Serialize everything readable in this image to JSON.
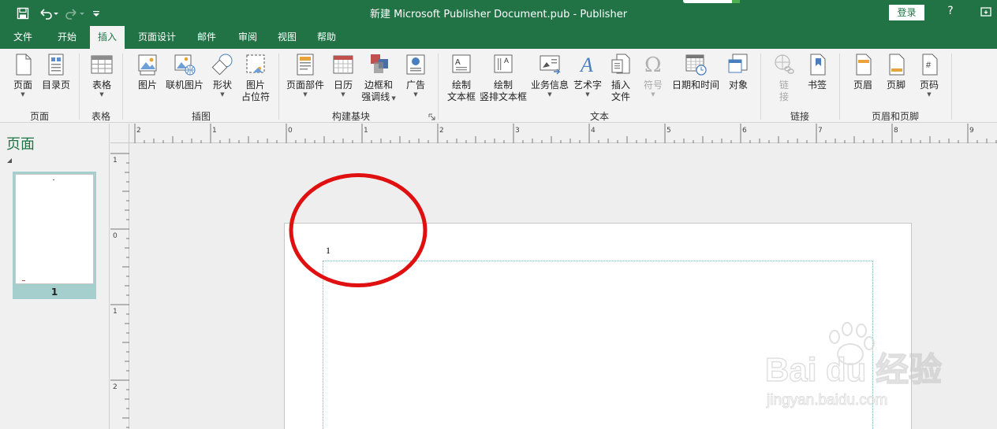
{
  "window": {
    "title": "新建 Microsoft Publisher Document.pub  -  Publisher",
    "login_label": "登录",
    "help_label": "?"
  },
  "tabs": [
    {
      "label": "文件",
      "active": false
    },
    {
      "label": "开始",
      "active": false
    },
    {
      "label": "插入",
      "active": true
    },
    {
      "label": "页面设计",
      "active": false
    },
    {
      "label": "邮件",
      "active": false
    },
    {
      "label": "审阅",
      "active": false
    },
    {
      "label": "视图",
      "active": false
    },
    {
      "label": "帮助",
      "active": false
    }
  ],
  "ribbon": {
    "buttons": {
      "page": "页面",
      "catalog_page": "目录页",
      "table": "表格",
      "picture": "图片",
      "online_picture": "联机图片",
      "shapes": "形状",
      "picture_placeholder_1": "图片",
      "picture_placeholder_2": "占位符",
      "page_parts": "页面部件",
      "calendar": "日历",
      "borders_1": "边框和",
      "borders_2": "强调线",
      "ads": "广告",
      "draw_textbox_1": "绘制",
      "draw_textbox_2": "文本框",
      "draw_vertical_1": "绘制",
      "draw_vertical_2": "竖排文本框",
      "business_info": "业务信息",
      "wordart": "艺术字",
      "insert_file_1": "插入",
      "insert_file_2": "文件",
      "symbol": "符号",
      "datetime": "日期和时间",
      "object": "对象",
      "link_1": "链",
      "link_2": "接",
      "bookmark": "书签",
      "header": "页眉",
      "footer": "页脚",
      "page_number": "页码"
    },
    "groups": {
      "pages": "页面",
      "tables": "表格",
      "illustrations": "插图",
      "building_blocks": "构建基块",
      "text": "文本",
      "links": "链接",
      "header_footer": "页眉和页脚"
    }
  },
  "pages_pane": {
    "title": "页面",
    "thumbnails": [
      {
        "number": "1",
        "selected": true
      }
    ]
  },
  "document": {
    "page_number_text": "1"
  },
  "rulers": {
    "horizontal_labels": [
      "2",
      "1",
      "0",
      "1",
      "2",
      "3",
      "4",
      "5",
      "6",
      "7",
      "8",
      "9"
    ],
    "vertical_labels": [
      "1",
      "0",
      "1",
      "2"
    ]
  },
  "watermark": {
    "text_top": "Bai du 经验",
    "text_bottom": "jingyan.baidu.com"
  },
  "colors": {
    "brand_green": "#217346",
    "annotation_red": "#e01010",
    "guide_blue": "#7fb8c8"
  }
}
